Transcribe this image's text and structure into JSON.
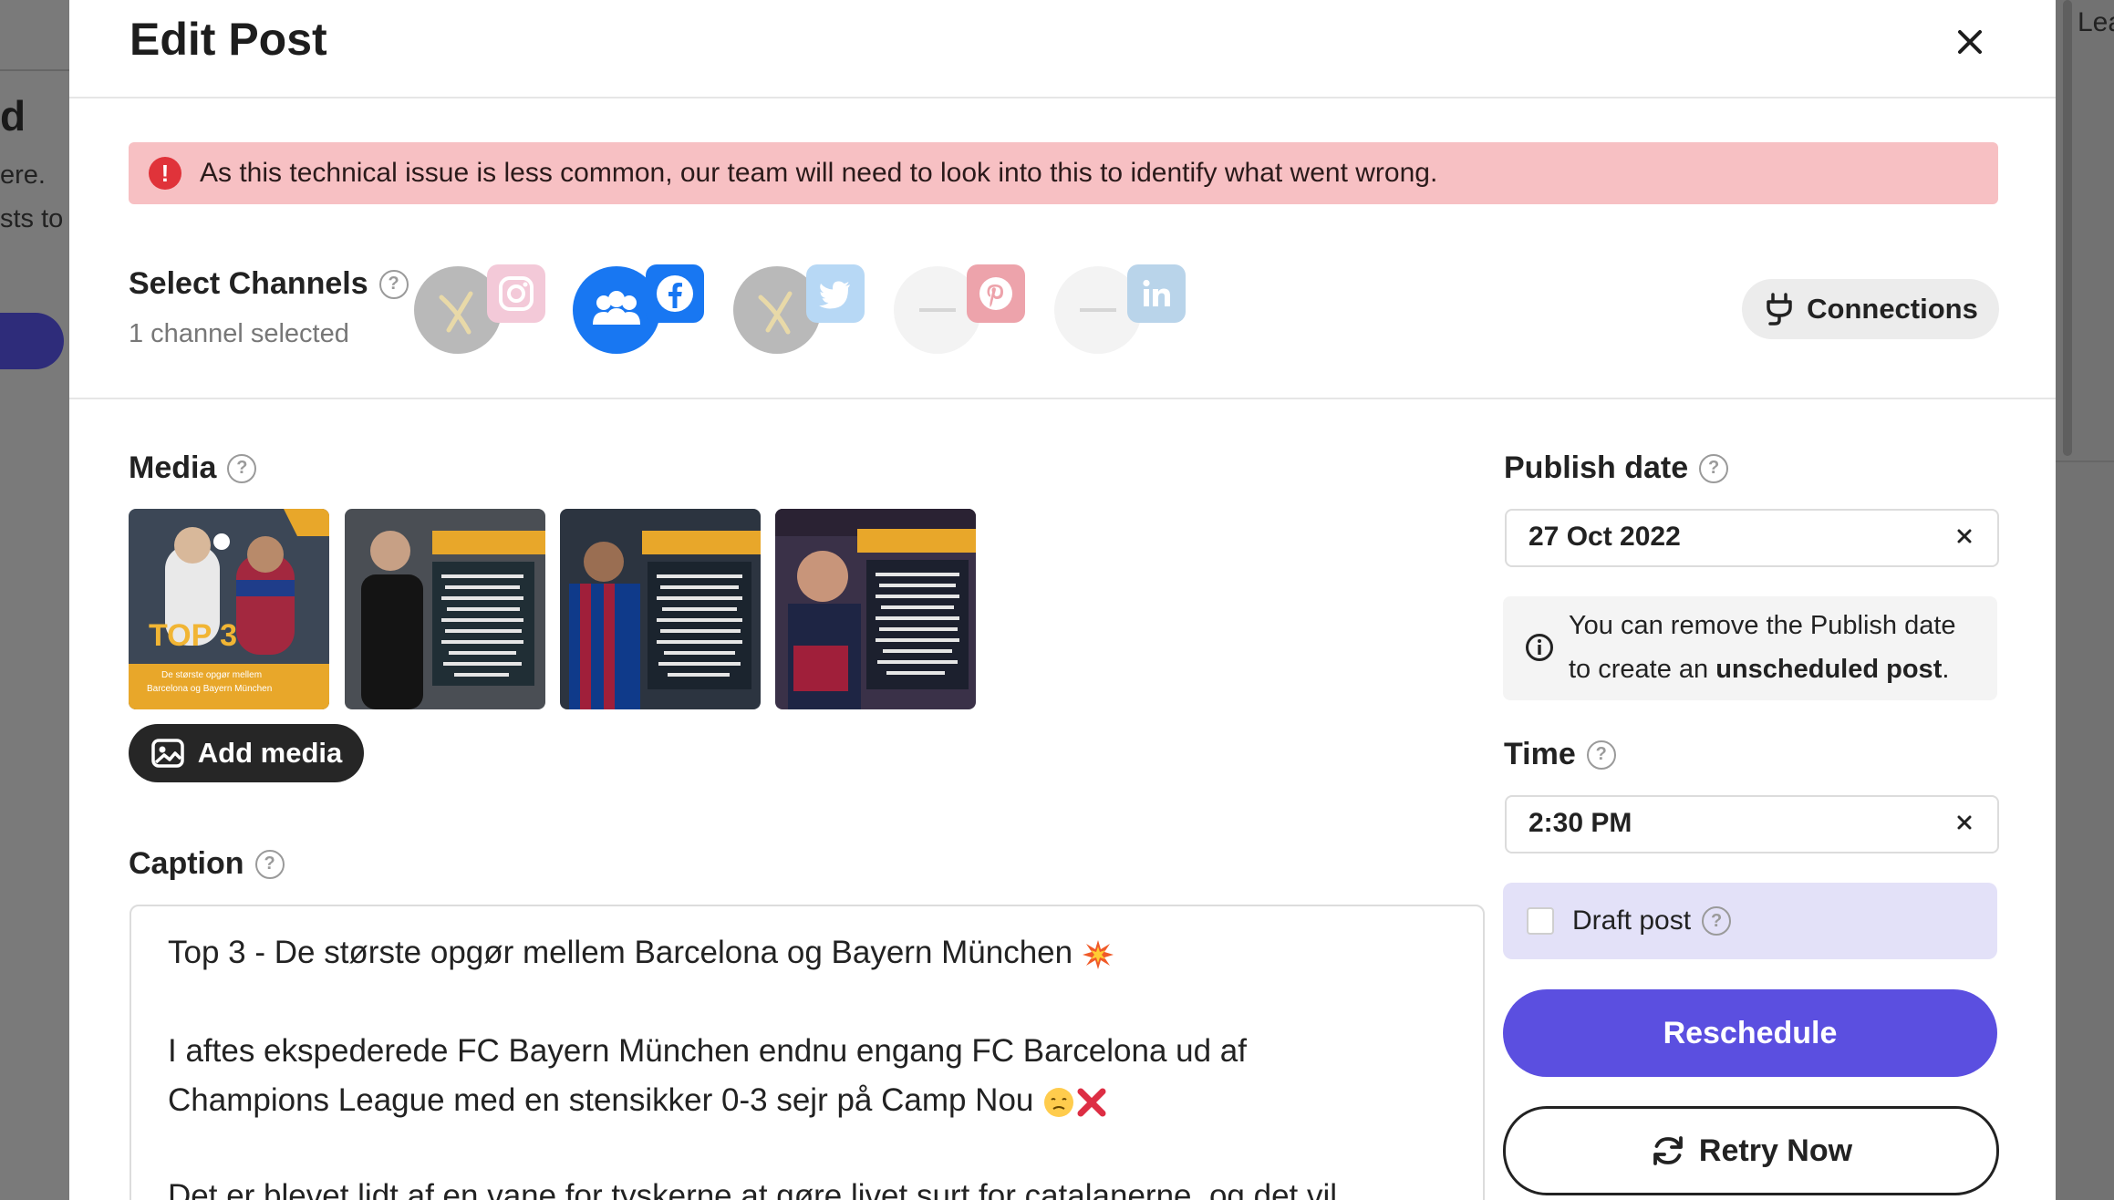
{
  "background": {
    "left_letter": "d",
    "left_fragment_1": "ere.",
    "left_fragment_2": "sts to",
    "right_fragment": "Lea"
  },
  "modal": {
    "title": "Edit Post",
    "close_icon": "close-icon"
  },
  "alert": {
    "icon": "alert-icon",
    "message": "As this technical issue is less common, our team will need to look into this to identify what went wrong."
  },
  "channels": {
    "label": "Select Channels",
    "count_text": "1 channel selected",
    "items": [
      {
        "network": "instagram",
        "selected": false,
        "avatar": "disabled-x"
      },
      {
        "network": "facebook",
        "selected": true,
        "avatar": "group"
      },
      {
        "network": "twitter",
        "selected": false,
        "avatar": "disabled-x"
      },
      {
        "network": "pinterest",
        "selected": false,
        "avatar": "empty"
      },
      {
        "network": "linkedin",
        "selected": false,
        "avatar": "empty"
      }
    ],
    "connections_label": "Connections"
  },
  "media": {
    "label": "Media",
    "thumbnails": [
      {
        "caption_text": "TOP 3",
        "sub_text": "De største opgør mellem Barcelona og Bayern München"
      },
      {
        "caption_text": "CHAMPIONS LEAGUE SEMIFINALEN 2012/13"
      },
      {
        "caption_text": "CHAMPIONS LEAGUE SEMIFINALEN 2014/15"
      },
      {
        "caption_text": "CHAMPIONS LEAGUE KVARTFINALEN 2019/20"
      }
    ],
    "add_label": "Add media"
  },
  "caption": {
    "label": "Caption",
    "line1": "Top 3 - De største opgør mellem Barcelona og Bayern München",
    "line2": "I aftes ekspederede FC Bayern München endnu engang FC Barcelona ud af",
    "line3": "Champions League med en stensikker 0-3 sejr på Camp Nou",
    "line4": "Det er blevet lidt af en vane for tyskerne at gøre livet surt for catalanerne, og det vil"
  },
  "publish": {
    "label": "Publish date",
    "value": "27 Oct 2022",
    "info_line1": "You can remove the Publish date",
    "info_line2_prefix": "to create an ",
    "info_line2_bold": "unscheduled post",
    "info_line2_suffix": "."
  },
  "time": {
    "label": "Time",
    "value": "2:30 PM"
  },
  "draft": {
    "label": "Draft post",
    "checked": false
  },
  "actions": {
    "reschedule_label": "Reschedule",
    "retry_label": "Retry Now"
  },
  "colors": {
    "primary": "#5b4fe0",
    "alert_bg": "#f7c0c3",
    "alert_icon": "#e0333a",
    "facebook": "#1877f2",
    "draft_bg": "#e3e1f8"
  }
}
